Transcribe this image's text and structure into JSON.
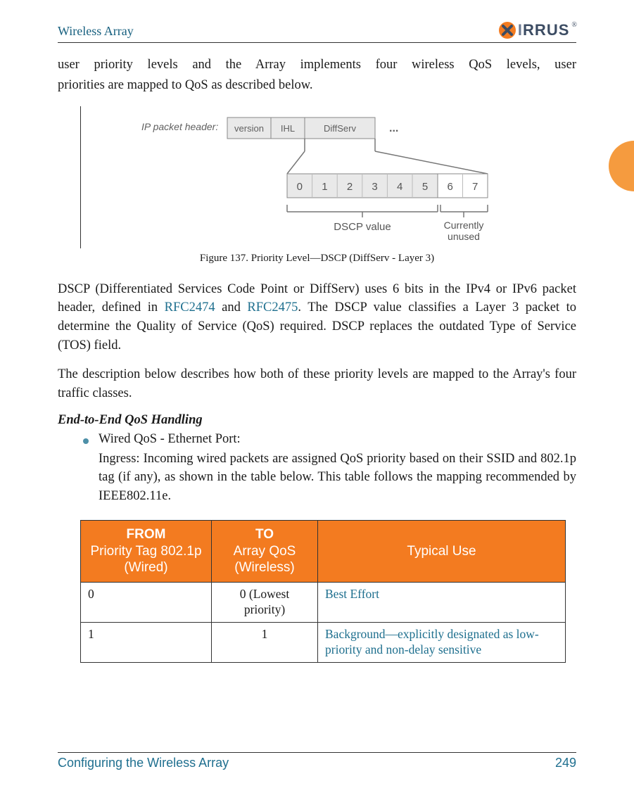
{
  "header": {
    "title": "Wireless Array",
    "brand_logo_alt": "Xirrus"
  },
  "intro_paragraph_1": "user priority levels and the Array implements four wireless QoS levels, user",
  "intro_paragraph_2": "priorities are mapped to QoS as described below.",
  "figure": {
    "caption": "Figure 137. Priority Level—DSCP (DiffServ - Layer 3)",
    "labels": {
      "ip_packet_header": "IP packet header:",
      "version": "version",
      "ihl": "IHL",
      "diffserv": "DiffServ",
      "dots": "...",
      "bits": [
        "0",
        "1",
        "2",
        "3",
        "4",
        "5",
        "6",
        "7"
      ],
      "dscp_value": "DSCP value",
      "currently_unused": "Currently\nunused"
    }
  },
  "para_dscp_pre": "DSCP (Differentiated Services Code Point or DiffServ) uses 6 bits in the IPv4 or IPv6 packet header, defined in ",
  "link_rfc2474": "RFC2474",
  "para_dscp_mid": " and ",
  "link_rfc2475": "RFC2475",
  "para_dscp_post": ". The DSCP value classifies a Layer 3 packet to determine the Quality of Service (QoS) required. DSCP replaces the outdated Type of Service (TOS) field.",
  "para_mapping": "The description below describes how both of these priority levels are mapped to the Array's four traffic classes.",
  "subheading": "End-to-End QoS Handling",
  "bullet1": "Wired QoS - Ethernet Port:",
  "ingress_para": "Ingress: Incoming wired packets are assigned QoS priority based on their SSID and 802.1p tag (if any), as shown in the table below. This table follows the mapping recommended by IEEE802.11e.",
  "table": {
    "headers": {
      "col1_bold": "FROM",
      "col1_rest": "Priority Tag 802.1p (Wired)",
      "col2_bold": "TO",
      "col2_rest": "Array QoS (Wireless)",
      "col3": "Typical Use"
    },
    "rows": [
      {
        "from": "0",
        "to": "0 (Lowest priority)",
        "use": "Best Effort"
      },
      {
        "from": "1",
        "to": "1",
        "use": "Background—explicitly designated as low-priority and non-delay sensitive"
      }
    ]
  },
  "footer": {
    "section": "Configuring the Wireless Array",
    "page": "249"
  }
}
